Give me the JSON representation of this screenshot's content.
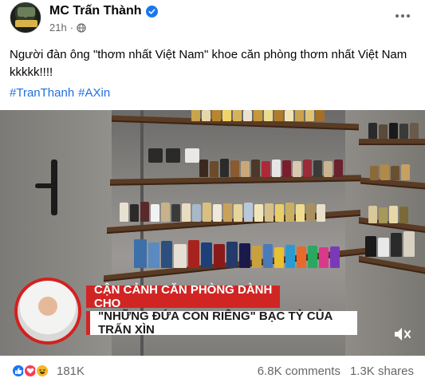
{
  "post": {
    "page_name": "MC Trấn Thành",
    "time": "21h",
    "separator": "·",
    "text": "Người đàn ông \"thơm nhất Việt Nam\" khoe căn phòng thơm nhất Việt Nam kkkkk!!!!",
    "hashtags": [
      "#TranThanh",
      "#AXin"
    ]
  },
  "video": {
    "caption_line1": "CẬN CẢNH CĂN PHÒNG DÀNH CHO",
    "caption_line2": "\"NHỮNG ĐỨA CON RIÊNG\" BẠC TỶ CỦA TRẤN XÌN"
  },
  "stats": {
    "reactions_count": "181K",
    "comments": "6.8K comments",
    "shares": "1.3K shares"
  },
  "icons": [
    "avatar",
    "verified-icon",
    "globe-icon",
    "more-icon",
    "mute-icon",
    "like-icon",
    "love-icon",
    "haha-icon"
  ],
  "colors": {
    "accent": "#1877f2",
    "hashtag": "#216fdb",
    "caption_red": "#d12524",
    "muted_text": "#65676b"
  }
}
